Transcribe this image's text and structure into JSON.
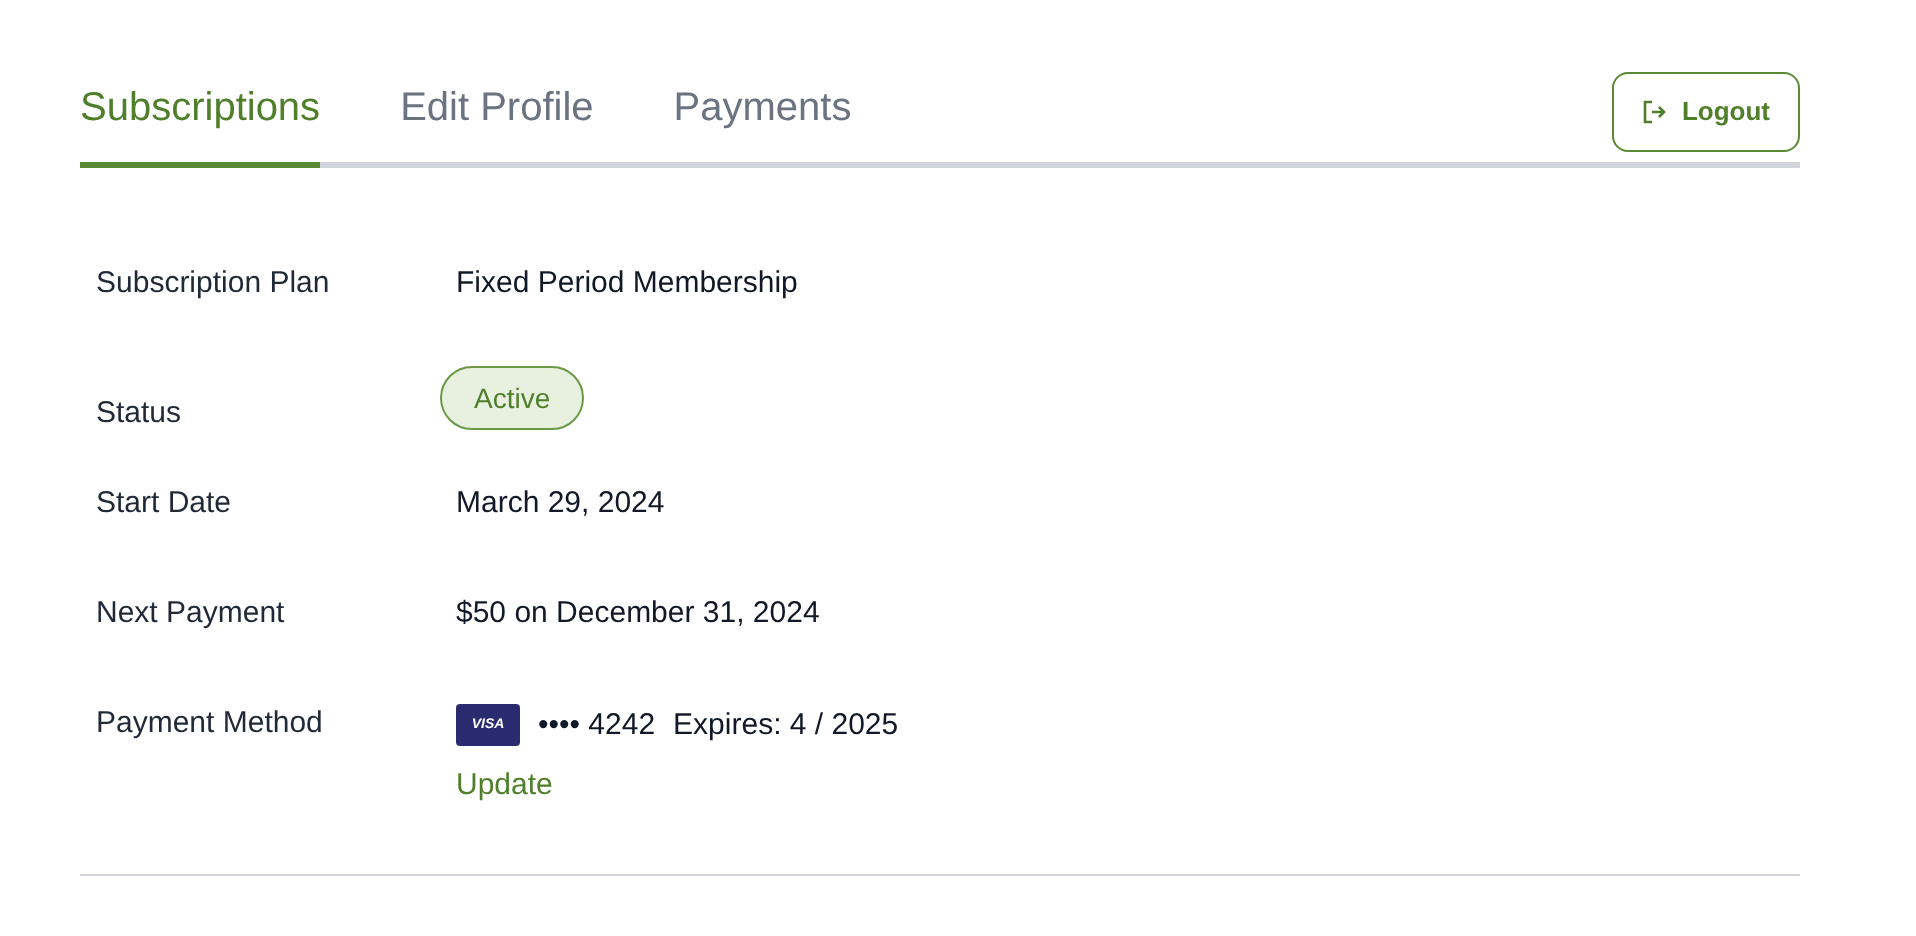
{
  "tabs": [
    {
      "label": "Subscriptions",
      "selected": true
    },
    {
      "label": "Edit Profile",
      "selected": false
    },
    {
      "label": "Payments",
      "selected": false
    }
  ],
  "logout_button": {
    "label": "Logout"
  },
  "details": [
    {
      "kind": "text",
      "label": "Subscription Plan",
      "value": "Fixed Period Membership"
    },
    {
      "kind": "badge",
      "label": "Status",
      "value": "Active"
    },
    {
      "kind": "text",
      "label": "Start Date",
      "value": "March 29, 2024"
    },
    {
      "kind": "text",
      "label": "Next Payment",
      "value": "$50 on December 31, 2024"
    },
    {
      "kind": "payment",
      "label": "Payment Method",
      "card_brand": "VISA",
      "card_number": "•••• 4242",
      "expires": "Expires: 4 / 2025",
      "link": "Update"
    }
  ]
}
